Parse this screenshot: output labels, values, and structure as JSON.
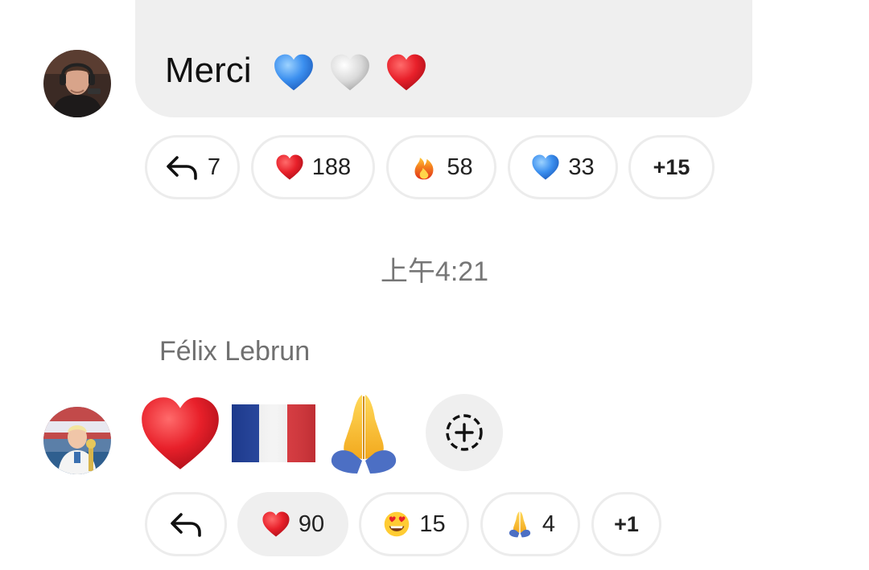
{
  "message1": {
    "text": "Merci",
    "emojis": [
      "blue-heart",
      "white-heart",
      "red-heart"
    ],
    "reactions": {
      "reply_count": "7",
      "items": [
        {
          "emoji": "red-heart",
          "count": "188"
        },
        {
          "emoji": "fire",
          "count": "58"
        },
        {
          "emoji": "blue-heart",
          "count": "33"
        }
      ],
      "more": "+15"
    }
  },
  "timestamp": "上午4:21",
  "message2": {
    "sender": "Félix Lebrun",
    "emojis": [
      "red-heart",
      "france-flag",
      "folded-hands"
    ],
    "reactions": {
      "items": [
        {
          "emoji": "red-heart",
          "count": "90",
          "selected": true
        },
        {
          "emoji": "heart-eyes-face",
          "count": "15"
        },
        {
          "emoji": "folded-hands",
          "count": "4"
        }
      ],
      "more": "+1"
    }
  },
  "colors": {
    "bubble": "#efefef",
    "pill_border": "#ececec",
    "timestamp": "#767676",
    "sender": "#707070"
  }
}
